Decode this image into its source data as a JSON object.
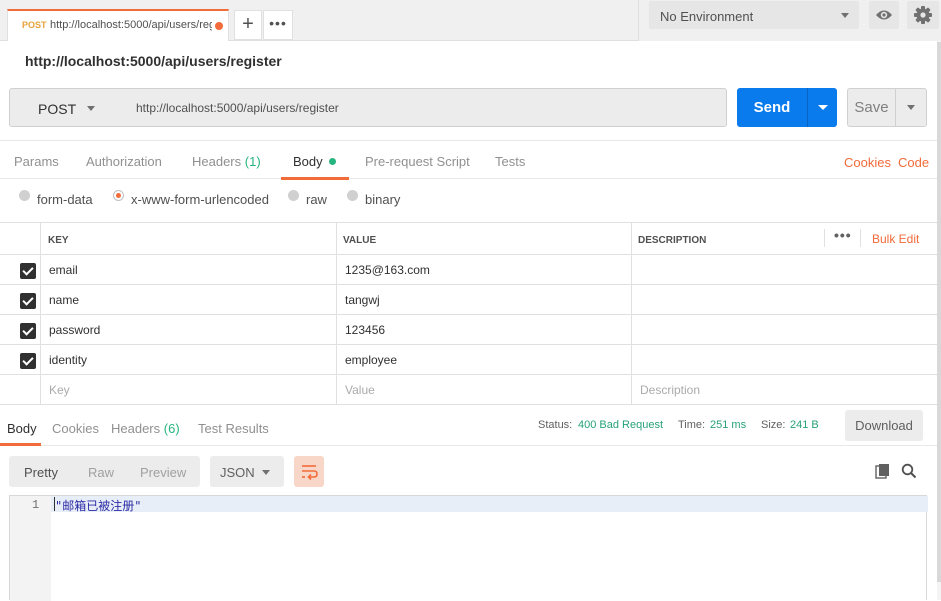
{
  "tab": {
    "method": "POST",
    "url": "http://localhost:5000/api/users/register",
    "modified": true
  },
  "new_tab_label": "+",
  "tab_more_label": "•••",
  "environment": {
    "selected": "No Environment"
  },
  "request_name": "http://localhost:5000/api/users/register",
  "request": {
    "method": "POST",
    "url": "http://localhost:5000/api/users/register",
    "send_label": "Send",
    "save_label": "Save"
  },
  "request_tabs": [
    {
      "label": "Params"
    },
    {
      "label": "Authorization"
    },
    {
      "label": "Headers",
      "count": "(1)"
    },
    {
      "label": "Body",
      "active": true
    },
    {
      "label": "Pre-request Script"
    },
    {
      "label": "Tests"
    }
  ],
  "request_links": {
    "cookies": "Cookies",
    "code": "Code"
  },
  "body_types": [
    {
      "label": "form-data",
      "selected": false
    },
    {
      "label": "x-www-form-urlencoded",
      "selected": true
    },
    {
      "label": "raw",
      "selected": false
    },
    {
      "label": "binary",
      "selected": false
    }
  ],
  "kv_table": {
    "headers": {
      "key": "KEY",
      "value": "VALUE",
      "description": "DESCRIPTION"
    },
    "more_label": "•••",
    "bulk_edit_label": "Bulk Edit",
    "rows": [
      {
        "checked": true,
        "key": "email",
        "value": "1235@163.com",
        "description": ""
      },
      {
        "checked": true,
        "key": "name",
        "value": "tangwj",
        "description": ""
      },
      {
        "checked": true,
        "key": "password",
        "value": "123456",
        "description": ""
      },
      {
        "checked": true,
        "key": "identity",
        "value": "employee",
        "description": ""
      }
    ],
    "placeholders": {
      "key": "Key",
      "value": "Value",
      "description": "Description"
    }
  },
  "response_tabs": [
    {
      "label": "Body",
      "active": true
    },
    {
      "label": "Cookies"
    },
    {
      "label": "Headers",
      "count": "(6)"
    },
    {
      "label": "Test Results"
    }
  ],
  "response_stats": {
    "status_label": "Status:",
    "status": "400 Bad Request",
    "time_label": "Time:",
    "time": "251 ms",
    "size_label": "Size:",
    "size": "241 B"
  },
  "download_label": "Download",
  "response_view": {
    "modes": [
      "Pretty",
      "Raw",
      "Preview"
    ],
    "active_mode": "Pretty",
    "format": "JSON"
  },
  "response_body": {
    "line_number": "1",
    "text": "\"邮箱已被注册\""
  },
  "colors": {
    "accent": "#f26b3a",
    "send": "#097bed",
    "success": "#26b47f"
  },
  "icons": [
    "add-tab-icon",
    "eye-icon",
    "gear-icon",
    "wrap-lines-icon",
    "copy-icon",
    "search-icon"
  ]
}
